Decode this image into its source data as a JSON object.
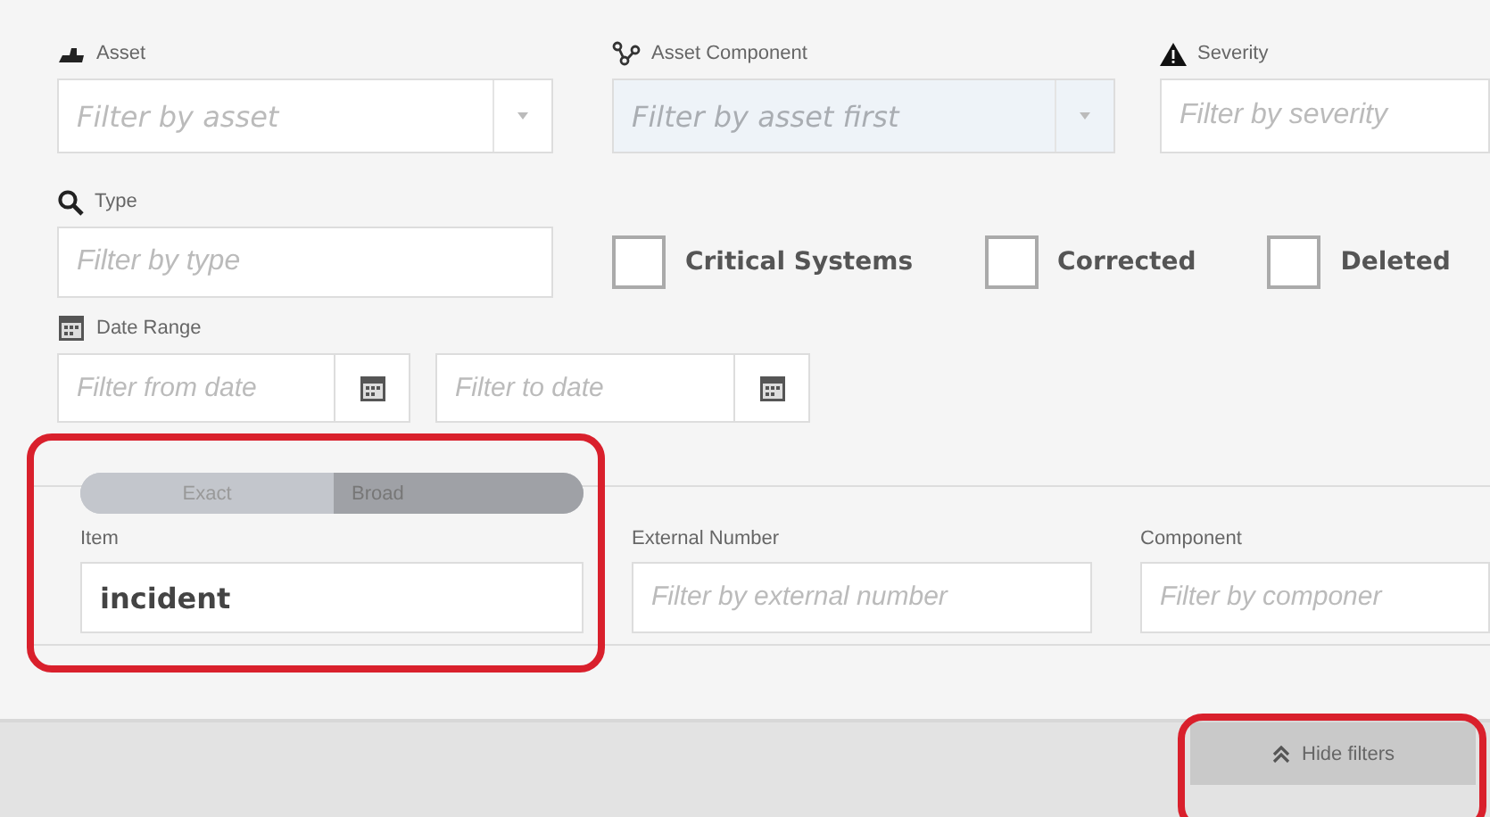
{
  "top_filters": [
    {
      "label": "Asset",
      "placeholder": "Filter by asset",
      "kind": "select",
      "disabled": false
    },
    {
      "label": "Asset Component",
      "placeholder": "Filter by asset first",
      "kind": "select",
      "disabled": true
    },
    {
      "label": "Severity",
      "placeholder": "Filter by severity",
      "kind": "text",
      "disabled": false
    }
  ],
  "type_filter": {
    "label": "Type",
    "placeholder": "Filter by type"
  },
  "checkboxes": [
    {
      "label": "Critical Systems",
      "checked": false
    },
    {
      "label": "Corrected",
      "checked": false
    },
    {
      "label": "Deleted",
      "checked": false
    }
  ],
  "date_range": {
    "label": "Date Range",
    "from_placeholder": "Filter from date",
    "to_placeholder": "Filter to date"
  },
  "search_panel": {
    "match_mode": [
      {
        "label": "Exact",
        "selected": false
      },
      {
        "label": "Broad",
        "selected": true
      }
    ],
    "fields": [
      {
        "label": "Item",
        "value": "incident",
        "highlighted": true
      },
      {
        "label": "External Number",
        "placeholder": "Filter by external number",
        "highlighted": false
      },
      {
        "label": "Component",
        "placeholder": "Filter by componer",
        "highlighted": false
      }
    ]
  },
  "hide_filters_button": {
    "label": "Hide filters",
    "highlighted": true
  }
}
